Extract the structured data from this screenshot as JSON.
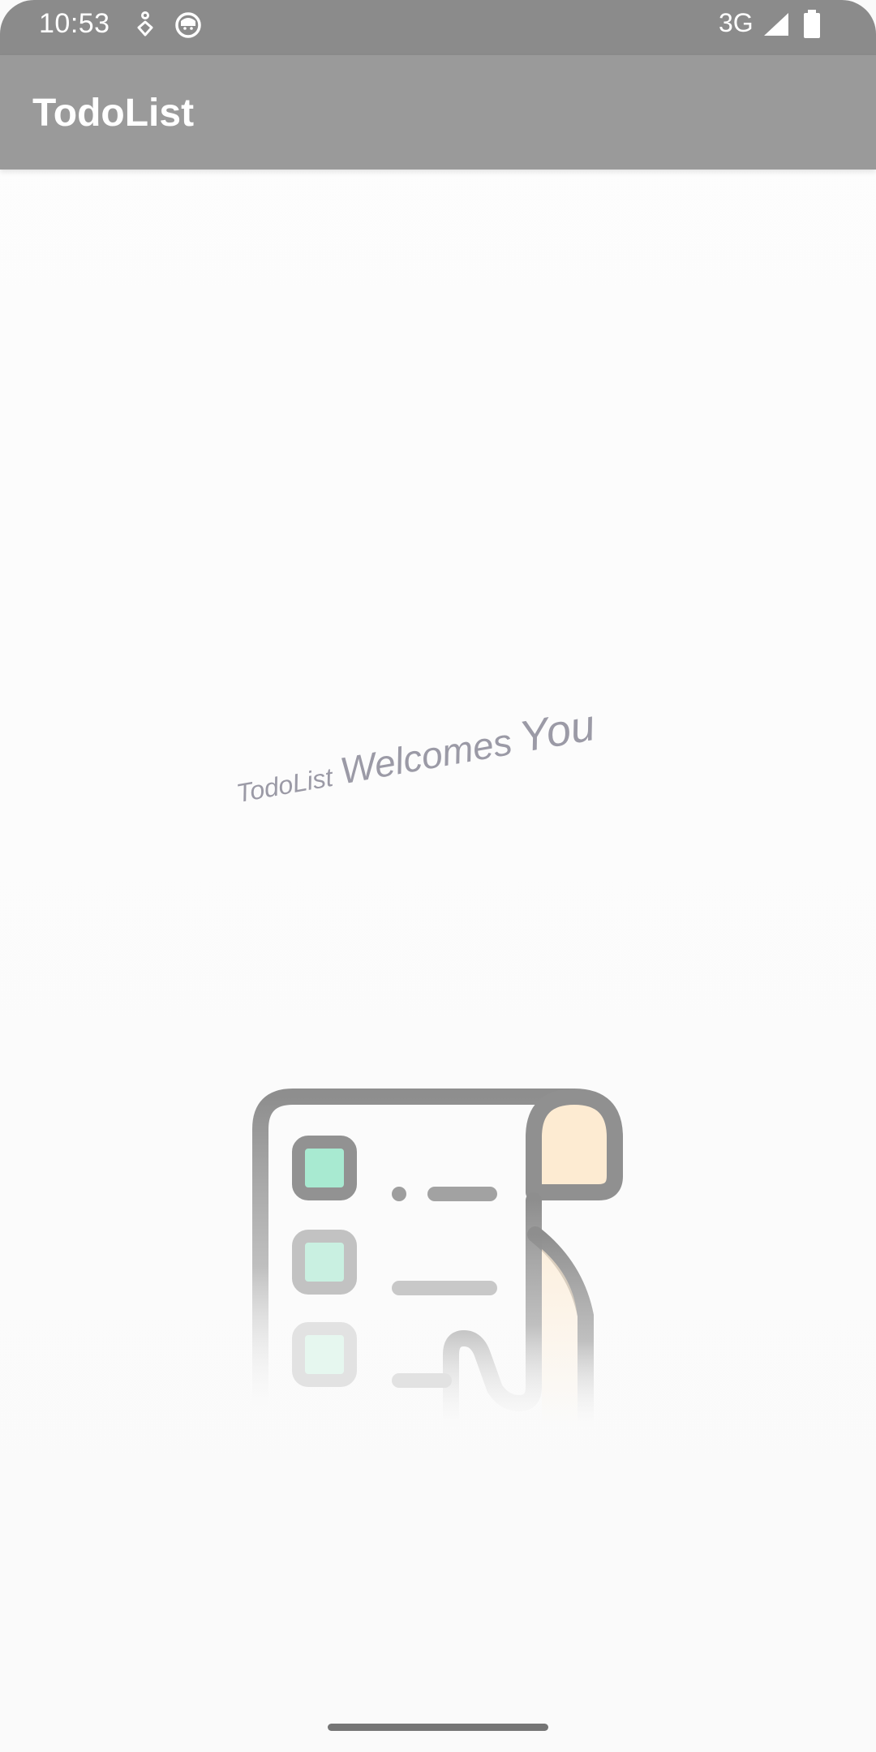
{
  "status_bar": {
    "time": "10:53",
    "network": "3G",
    "icons": [
      "accessibility-icon",
      "cat-face-icon",
      "cell-signal-icon",
      "battery-icon"
    ]
  },
  "app_bar": {
    "title": "TodoList"
  },
  "welcome": {
    "words": [
      "TodoList",
      "Welcomes",
      "You"
    ]
  },
  "illustration": {
    "icon": "todo-list-scroll-icon",
    "checkbox_color": "#a8ead1",
    "scroll_tab_color": "#fdebd2"
  },
  "colors": {
    "status_bar_bg": "#8b8b8b",
    "app_bar_bg": "#9a9a9a",
    "welcome_text": "#9b9aa6"
  }
}
